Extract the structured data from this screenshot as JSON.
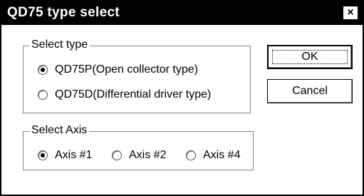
{
  "window": {
    "title": "QD75 type select",
    "close_symbol": "×"
  },
  "select_type": {
    "label": "Select type",
    "options": [
      {
        "label": "QD75P(Open collector type)",
        "checked": true
      },
      {
        "label": "QD75D(Differential driver type)",
        "checked": false
      }
    ]
  },
  "select_axis": {
    "label": "Select Axis",
    "options": [
      {
        "label": "Axis #1",
        "checked": true
      },
      {
        "label": "Axis #2",
        "checked": false
      },
      {
        "label": "Axis #4",
        "checked": false
      }
    ]
  },
  "buttons": {
    "ok": "OK",
    "cancel": "Cancel"
  }
}
